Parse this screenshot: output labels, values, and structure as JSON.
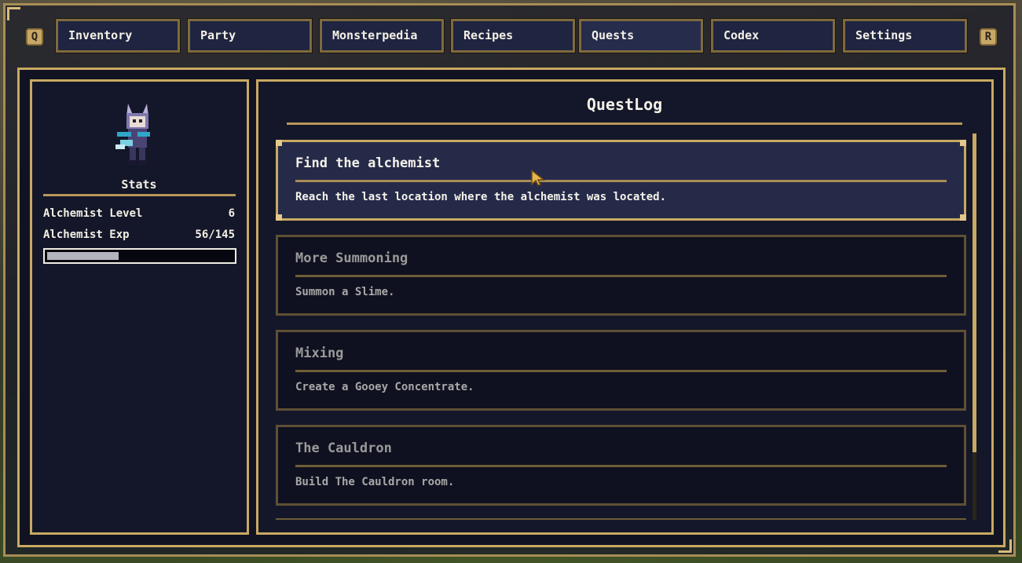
{
  "nav": {
    "left_shoulder": "Q",
    "right_shoulder": "R",
    "tabs": [
      "Inventory",
      "Party",
      "Monsterpedia",
      "Recipes",
      "Quests",
      "Codex",
      "Settings"
    ]
  },
  "stats": {
    "heading": "Stats",
    "level_label": "Alchemist Level",
    "level_value": "6",
    "exp_label": "Alchemist Exp",
    "exp_value": "56/145",
    "exp_progress": 0.386
  },
  "quest_log": {
    "title": "QuestLog",
    "quests": [
      {
        "title": "Find the alchemist",
        "desc": "Reach the last location where the alchemist was located."
      },
      {
        "title": "More Summoning",
        "desc": "Summon a Slime."
      },
      {
        "title": "Mixing",
        "desc": "Create a Gooey Concentrate."
      },
      {
        "title": "The Cauldron",
        "desc": "Build The Cauldron room."
      }
    ]
  },
  "colors": {
    "gold": "#c9a962",
    "panel": "#141729",
    "selected": "#252a49"
  }
}
